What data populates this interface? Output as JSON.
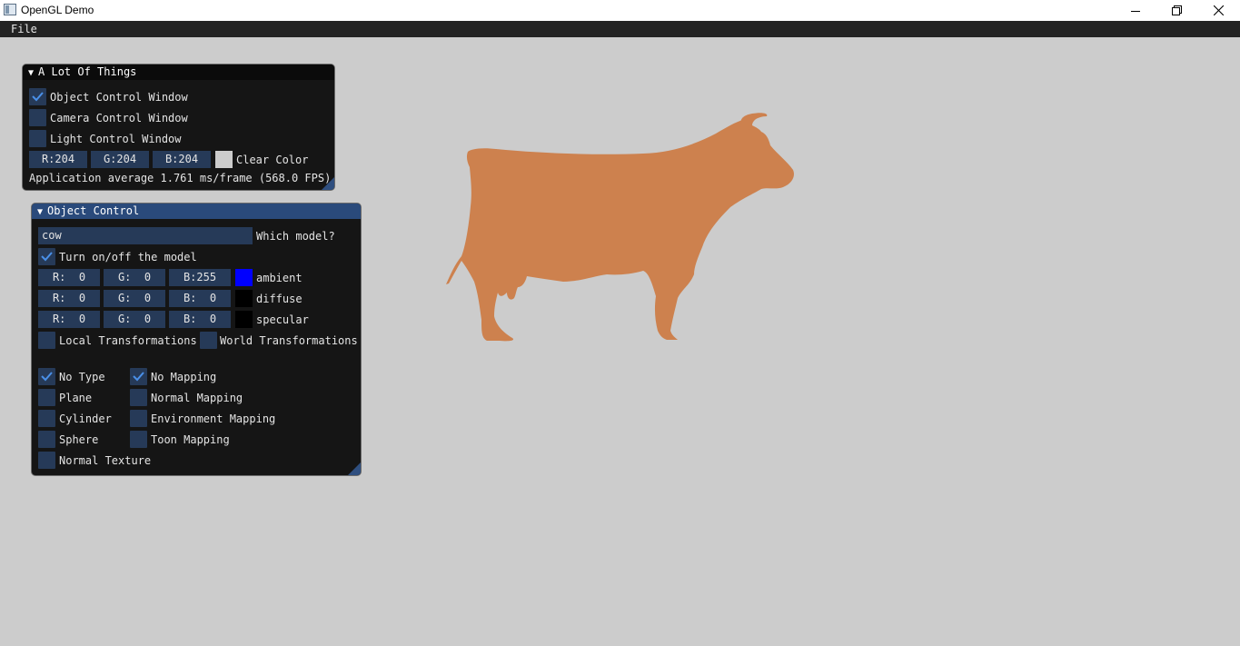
{
  "window": {
    "title": "OpenGL Demo",
    "icon": "app-window-icon",
    "controls": [
      "minimize-icon",
      "restore-icon",
      "close-icon"
    ]
  },
  "menubar": {
    "file": "File"
  },
  "panel1": {
    "title": "A Lot Of Things",
    "object_control": {
      "label": "Object Control Window",
      "checked": true
    },
    "camera_control": {
      "label": "Camera Control Window",
      "checked": false
    },
    "light_control": {
      "label": "Light Control Window",
      "checked": false
    },
    "clear_r": "R:204",
    "clear_g": "G:204",
    "clear_b": "B:204",
    "clear_color_label": "Clear Color",
    "clear_color_hex": "#cccccc",
    "stats": "Application average 1.761 ms/frame (568.0 FPS)"
  },
  "panel2": {
    "title": "Object Control",
    "model_value": "cow",
    "model_label": "Which model?",
    "toggle_model": {
      "label": "Turn on/off the model",
      "checked": true
    },
    "ambient": {
      "r": "R:  0",
      "g": "G:  0",
      "b": "B:255",
      "label": "ambient",
      "color": "#0000ff"
    },
    "diffuse": {
      "r": "R:  0",
      "g": "G:  0",
      "b": "B:  0",
      "label": "diffuse",
      "color": "#000000"
    },
    "specular": {
      "r": "R:  0",
      "g": "G:  0",
      "b": "B:  0",
      "label": "specular",
      "color": "#000000"
    },
    "local_transform": {
      "label": "Local Transformations",
      "checked": false
    },
    "world_transform": {
      "label": "World Transformations",
      "checked": false
    },
    "types": [
      {
        "label": "No Type",
        "checked": true
      },
      {
        "label": "Plane",
        "checked": false
      },
      {
        "label": "Cylinder",
        "checked": false
      },
      {
        "label": "Sphere",
        "checked": false
      },
      {
        "label": "Normal Texture",
        "checked": false
      }
    ],
    "mappings": [
      {
        "label": "No Mapping",
        "checked": true
      },
      {
        "label": "Normal Mapping",
        "checked": false
      },
      {
        "label": "Environment Mapping",
        "checked": false
      },
      {
        "label": "Toon Mapping",
        "checked": false
      }
    ]
  },
  "scene": {
    "model_color": "#cd814e",
    "background": "#cccccc"
  }
}
